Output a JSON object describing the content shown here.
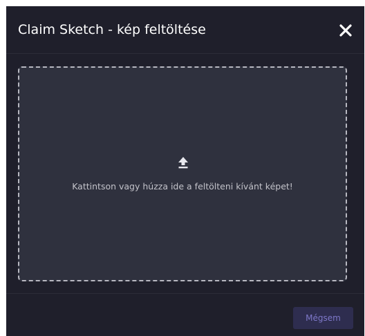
{
  "modal": {
    "title": "Claim Sketch - kép feltöltése",
    "close_icon": "close-icon",
    "dropzone": {
      "icon": "upload-icon",
      "text": "Kattintson vagy húzza ide a feltölteni kívánt képet!"
    },
    "footer": {
      "cancel_label": "Mégsem"
    }
  },
  "colors": {
    "modal_bg": "#1f1f2b",
    "dropzone_bg": "#2f313e",
    "dropzone_border": "#b9b9c2",
    "title_text": "#ffffff",
    "dropzone_text": "#c3c3ca",
    "cancel_bg": "#2e2d4f",
    "cancel_text": "#7e78c9"
  }
}
